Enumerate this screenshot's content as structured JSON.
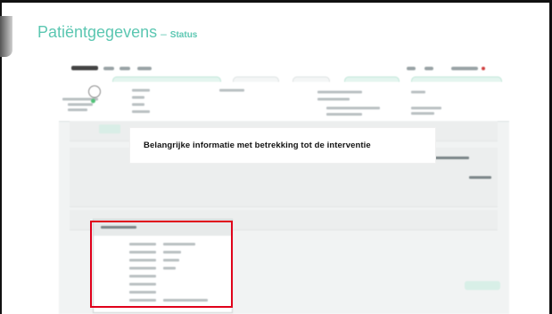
{
  "header": {
    "title": "Patiëntgegevens",
    "separator": "–",
    "subtitle": "Status"
  },
  "callout": {
    "text": "Belangrijke informatie met betrekking tot de interventie"
  },
  "colors": {
    "title_accent": "#5cc7b2",
    "highlight_border": "#e0001b",
    "frame": "#111111"
  },
  "icons": {
    "avatar": "user-avatar-icon",
    "status": "status-dot-icon"
  }
}
